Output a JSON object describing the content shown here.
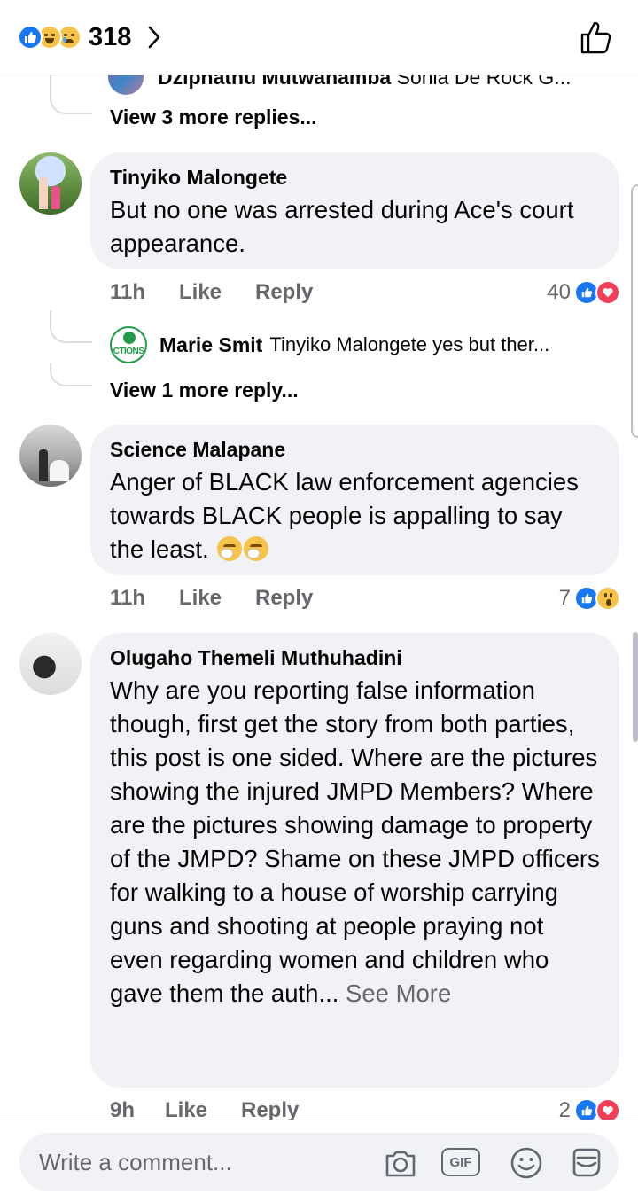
{
  "header": {
    "reaction_count": "318",
    "reaction_icons": [
      "like-icon",
      "haha-icon",
      "sad-icon"
    ],
    "like_icon": "thumbs-up-outline-icon"
  },
  "feed": {
    "clipped_reply": {
      "author": "Dziphathu Mutwanamba",
      "text": "Sonia De Rock G..."
    },
    "view_more_1": "View 3 more replies...",
    "comments": [
      {
        "author": "Tinyiko Malongete",
        "text": "But no one was arrested during Ace's court appearance.",
        "time": "11h",
        "like_label": "Like",
        "reply_label": "Reply",
        "reaction_count": "40",
        "reactions": [
          "like",
          "love"
        ]
      },
      {
        "author": "Science Malapane",
        "text": "Anger of BLACK law enforcement agencies towards BLACK people is appalling to say the least.",
        "emoji": [
          "thinking-face",
          "thinking-face"
        ],
        "time": "11h",
        "like_label": "Like",
        "reply_label": "Reply",
        "reaction_count": "7",
        "reactions": [
          "like",
          "wow"
        ]
      },
      {
        "author": "Olugaho Themeli Muthuhadini",
        "text": "Why are you reporting false information though,  first get the story from both parties, this post is one sided. Where are the pictures showing the injured JMPD Members? Where are the pictures showing damage to property of the JMPD? Shame on these JMPD officers for walking to a house of worship carrying guns and shooting at people praying not even regarding women and children who gave them the auth...",
        "see_more": "See More",
        "time": "9h",
        "like_label": "Like",
        "reply_label": "Reply",
        "reaction_count": "2",
        "reactions": [
          "like",
          "love"
        ]
      }
    ],
    "nested_reply": {
      "avatar_text": "CTIONS",
      "author": "Marie Smit",
      "text": "Tinyiko Malongete yes but ther..."
    },
    "view_more_2": "View 1 more reply..."
  },
  "composer": {
    "placeholder": "Write a comment...",
    "gif_label": "GIF",
    "tools": [
      "camera-icon",
      "gif-icon",
      "emoji-icon",
      "sticker-icon"
    ]
  },
  "colors": {
    "like_blue": "#1877f2",
    "love_red": "#f33e58",
    "bubble_bg": "#f0f2f5",
    "meta_gray": "#65676b"
  }
}
